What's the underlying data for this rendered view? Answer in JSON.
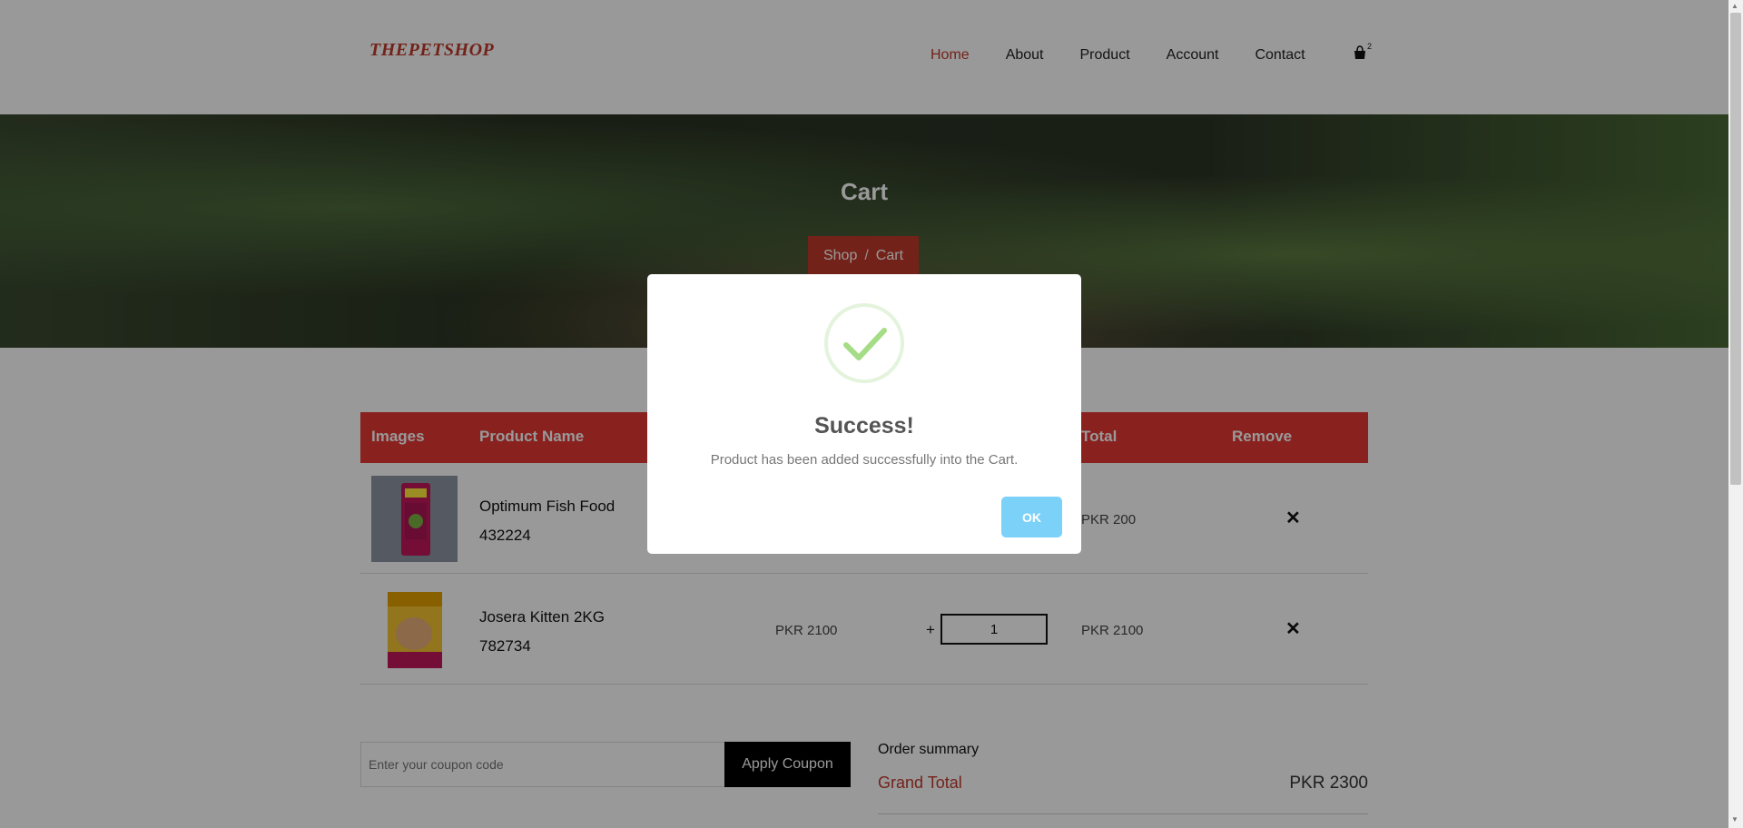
{
  "header": {
    "logo": "THEPETSHOP",
    "nav": [
      "Home",
      "About",
      "Product",
      "Account",
      "Contact"
    ],
    "cart_count": "2"
  },
  "hero": {
    "title": "Cart",
    "breadcrumb": {
      "shop": "Shop",
      "separator": "/",
      "current": "Cart"
    }
  },
  "table": {
    "headers": [
      "Images",
      "Product Name",
      "Total",
      "Remove"
    ],
    "rows": [
      {
        "name": "Optimum Fish Food",
        "code": "432224",
        "price": "",
        "qty": "",
        "total": "PKR 200",
        "remove": "✕"
      },
      {
        "name": "Josera Kitten 2KG",
        "code": "782734",
        "price": "PKR 2100",
        "qty": "1",
        "total": "PKR 2100",
        "remove": "✕"
      }
    ]
  },
  "coupon": {
    "placeholder": "Enter your coupon code",
    "button": "Apply Coupon"
  },
  "summary": {
    "title": "Order summary",
    "grand_label": "Grand Total",
    "grand_value": "PKR 2300"
  },
  "modal": {
    "title": "Success!",
    "text": "Product has been added successfully into the Cart.",
    "ok": "OK"
  },
  "colors": {
    "accent": "#c0392b",
    "header_red": "#e53935",
    "ok_button": "#7cd1f9",
    "success": "#a5dc86"
  },
  "icons": [
    "cart-icon",
    "success-check-icon",
    "remove-icon"
  ]
}
